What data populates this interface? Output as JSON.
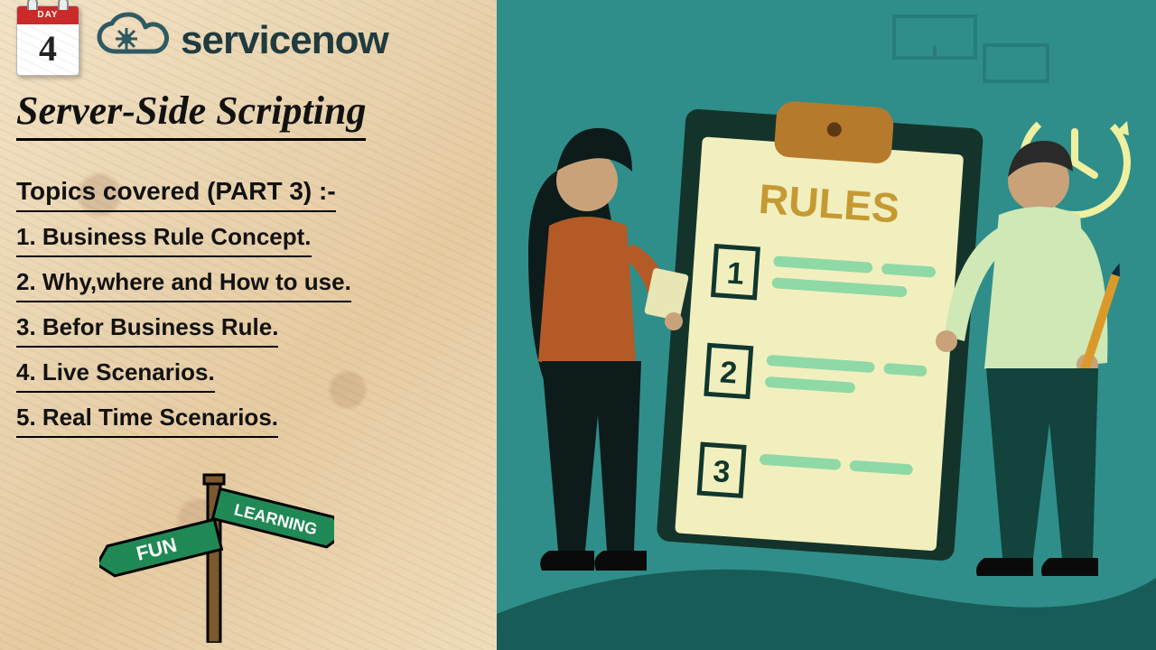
{
  "calendar": {
    "label": "DAY",
    "number": "4"
  },
  "logo": {
    "word_light": "service",
    "word_bold": "now"
  },
  "title": "Server-Side Scripting",
  "subtitle": "Topics covered (PART 3) :-",
  "topics": [
    "1. Business Rule Concept.",
    "2. Why,where and How to use.",
    "3. Befor Business Rule.",
    "4. Live Scenarios.",
    "5. Real Time Scenarios."
  ],
  "signpost": {
    "left": "FUN",
    "right": "LEARNING"
  },
  "clipboard": {
    "heading": "RULES",
    "items": [
      "1",
      "2",
      "3"
    ]
  }
}
